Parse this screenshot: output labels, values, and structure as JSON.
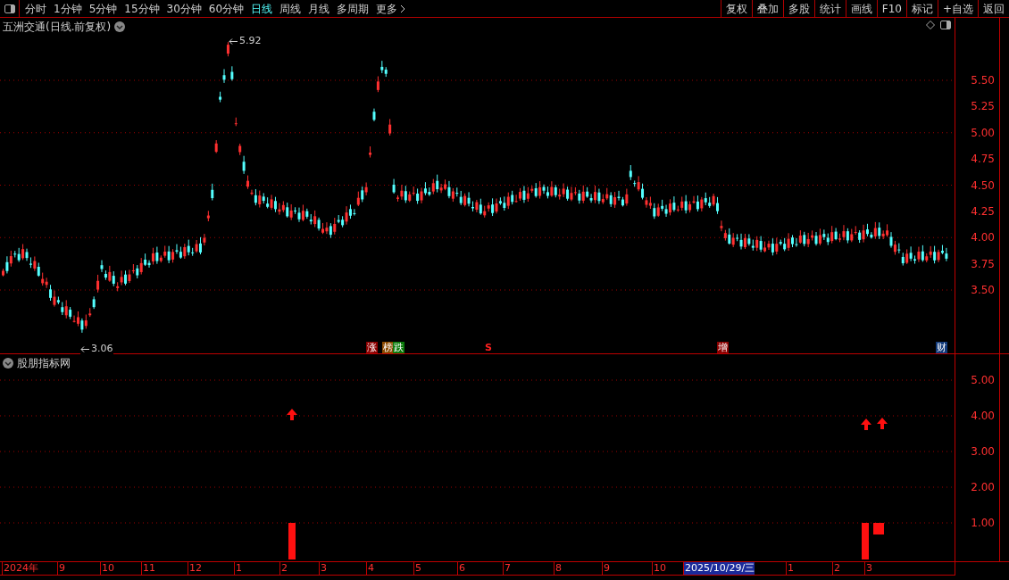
{
  "toolbar": {
    "periods": [
      {
        "label": "分时",
        "selected": false
      },
      {
        "label": "1分钟",
        "selected": false
      },
      {
        "label": "5分钟",
        "selected": false
      },
      {
        "label": "15分钟",
        "selected": false
      },
      {
        "label": "30分钟",
        "selected": false
      },
      {
        "label": "60分钟",
        "selected": false
      },
      {
        "label": "日线",
        "selected": true
      },
      {
        "label": "周线",
        "selected": false
      },
      {
        "label": "月线",
        "selected": false
      },
      {
        "label": "多周期",
        "selected": false
      }
    ],
    "more": "更多",
    "actions": [
      "复权",
      "叠加",
      "多股",
      "统计",
      "画线",
      "F10",
      "标记",
      "+自选",
      "返回"
    ]
  },
  "main_chart": {
    "title": "五洲交通(日线.前复权)",
    "y_ticks": [
      "5.50",
      "5.25",
      "5.00",
      "4.75",
      "4.50",
      "4.25",
      "4.00",
      "3.75",
      "3.50"
    ],
    "high_label": "5.92",
    "low_label": "3.06",
    "events": [
      {
        "label": "涨",
        "kind": "badge",
        "color": "#8b0000"
      },
      {
        "label": "榜",
        "kind": "badge",
        "color": "#8b4a00"
      },
      {
        "label": "跌",
        "kind": "badge",
        "color": "#0a7a0a"
      },
      {
        "label": "S",
        "kind": "mark",
        "color": "#ff2020"
      },
      {
        "label": "增",
        "kind": "badge",
        "color": "#8b0000"
      },
      {
        "label": "财",
        "kind": "badge",
        "color": "#123a7a"
      }
    ]
  },
  "indicator": {
    "title": "股朋指标网",
    "y_ticks": [
      "5.00",
      "4.00",
      "3.00",
      "2.00",
      "1.00"
    ]
  },
  "date_axis": {
    "labels": [
      {
        "label": "2024年",
        "selected": false
      },
      {
        "label": "9",
        "selected": false
      },
      {
        "label": "10",
        "selected": false
      },
      {
        "label": "11",
        "selected": false
      },
      {
        "label": "12",
        "selected": false
      },
      {
        "label": "1",
        "selected": false
      },
      {
        "label": "2",
        "selected": false
      },
      {
        "label": "3",
        "selected": false
      },
      {
        "label": "4",
        "selected": false
      },
      {
        "label": "5",
        "selected": false
      },
      {
        "label": "6",
        "selected": false
      },
      {
        "label": "7",
        "selected": false
      },
      {
        "label": "8",
        "selected": false
      },
      {
        "label": "9",
        "selected": false
      },
      {
        "label": "10",
        "selected": false
      },
      {
        "label": "2025/10/29/三",
        "selected": true
      },
      {
        "label": "1",
        "selected": false
      },
      {
        "label": "2",
        "selected": false
      },
      {
        "label": "3",
        "selected": false
      }
    ]
  }
}
